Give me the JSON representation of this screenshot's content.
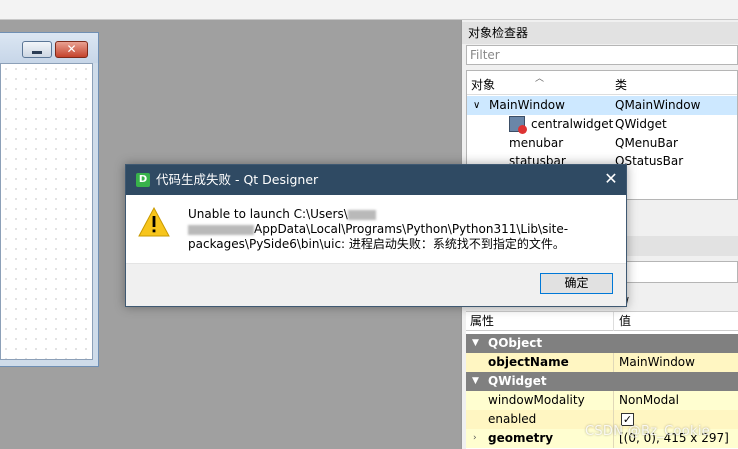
{
  "object_inspector": {
    "title": "对象检查器",
    "filter_placeholder": "Filter",
    "columns": {
      "object": "对象",
      "class": "类"
    },
    "rows": [
      {
        "object": "MainWindow",
        "class": "QMainWindow",
        "selected": true
      },
      {
        "object": "centralwidget",
        "class": "QWidget"
      },
      {
        "object": "menubar",
        "class": "QMenuBar"
      },
      {
        "object": "statusbar",
        "class": "QStatusBar"
      }
    ]
  },
  "property_editor": {
    "partial_header": "ow",
    "columns": {
      "property": "属性",
      "value": "值"
    },
    "categories": {
      "qobject": "QObject",
      "qwidget": "QWidget"
    },
    "rows": [
      {
        "name": "objectName",
        "value": "MainWindow"
      },
      {
        "name": "windowModality",
        "value": "NonModal"
      },
      {
        "name": "enabled",
        "value": "✓"
      },
      {
        "name": "geometry",
        "value": "[(0, 0), 415 x 297]"
      }
    ]
  },
  "form_window": {
    "close_glyph": "✕"
  },
  "dialog": {
    "app_icon": "D",
    "title": "代码生成失败 - Qt Designer",
    "close_glyph": "✕",
    "message_line1": "Unable to launch C:\\Users\\",
    "message_line2_tail": "AppData\\Local\\Programs\\Python\\Python311\\Lib\\site-",
    "message_line3": "packages\\PySide6\\bin\\uic: 进程启动失败：系统找不到指定的文件。",
    "ok_label": "确定",
    "icon": "warning-icon"
  },
  "watermark": "CSDN @Bz_Cookie",
  "colors": {
    "dialog_title_bar": "#2f4a63",
    "category_row": "#808080",
    "selected_row": "#cde8ff",
    "property_row": "#fffed0",
    "ok_border": "#0078d7"
  }
}
